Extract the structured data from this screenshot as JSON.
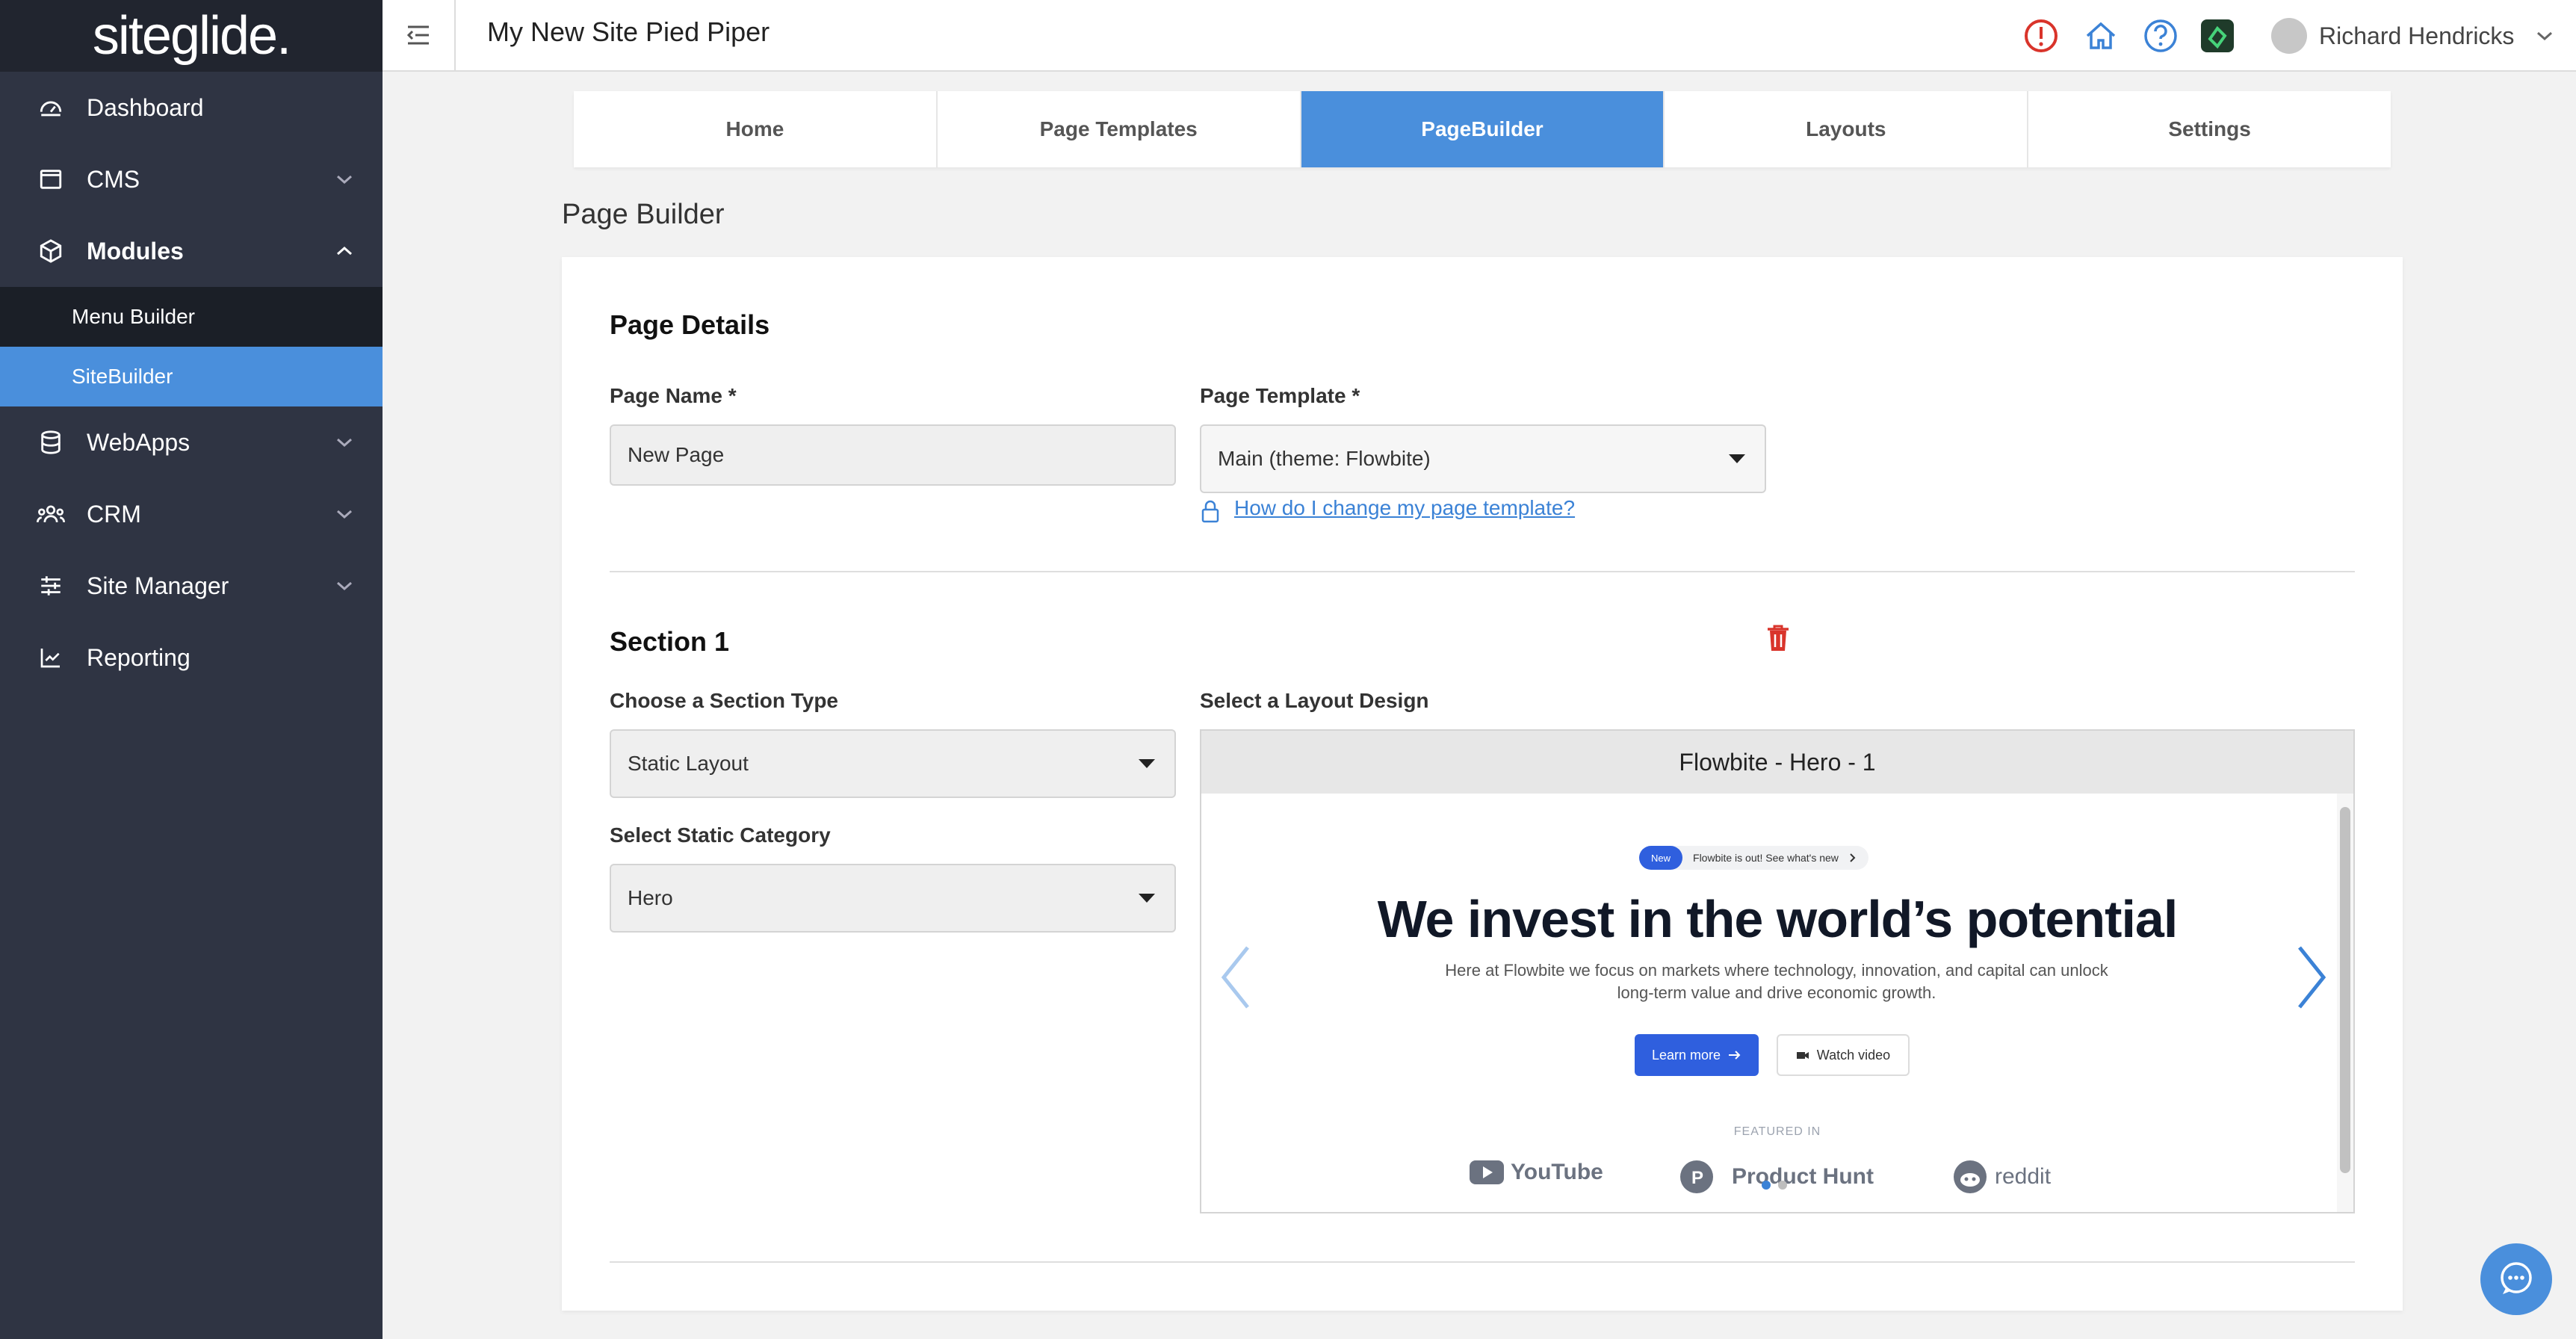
{
  "brand": {
    "logo_text": "siteglide."
  },
  "sidebar": {
    "items": [
      {
        "label": "Dashboard",
        "icon": "dashboard-icon"
      },
      {
        "label": "CMS",
        "icon": "cms-icon"
      },
      {
        "label": "Modules",
        "icon": "cube-icon"
      },
      {
        "label": "WebApps",
        "icon": "database-icon"
      },
      {
        "label": "CRM",
        "icon": "users-icon"
      },
      {
        "label": "Site Manager",
        "icon": "sliders-icon"
      },
      {
        "label": "Reporting",
        "icon": "chart-icon"
      }
    ],
    "modules_sub": [
      {
        "label": "Menu Builder"
      },
      {
        "label": "SiteBuilder"
      }
    ]
  },
  "header": {
    "site_title": "My New Site Pied Piper",
    "user_name": "Richard Hendricks"
  },
  "tabs": [
    {
      "label": "Home"
    },
    {
      "label": "Page Templates"
    },
    {
      "label": "PageBuilder"
    },
    {
      "label": "Layouts"
    },
    {
      "label": "Settings"
    }
  ],
  "page": {
    "heading": "Page Builder",
    "details_title": "Page Details",
    "page_name_label": "Page Name  *",
    "page_name_value": "New Page",
    "page_template_label": "Page Template  *",
    "page_template_value": "Main (theme: Flowbite)",
    "template_help_link": "How do I change my page template?",
    "section_title": "Section 1",
    "section_type_label": "Choose a Section Type",
    "section_type_value": "Static Layout",
    "static_category_label": "Select Static Category",
    "static_category_value": "Hero",
    "layout_design_label": "Select a Layout Design"
  },
  "preview": {
    "title": "Flowbite - Hero - 1",
    "badge": "New",
    "announcement": "Flowbite is out! See what's new",
    "hero_title": "We invest in the world’s potential",
    "hero_text": "Here at Flowbite we focus on markets where technology, innovation, and capital can unlock long-term value and drive economic growth.",
    "primary_button": "Learn more",
    "secondary_button": "Watch video",
    "featured_label": "FEATURED IN",
    "brands": [
      "YouTube",
      "Product Hunt",
      "reddit"
    ]
  },
  "colors": {
    "accent": "#4a8fdc",
    "sidebar_bg": "#2f3443",
    "danger": "#d9342b"
  }
}
